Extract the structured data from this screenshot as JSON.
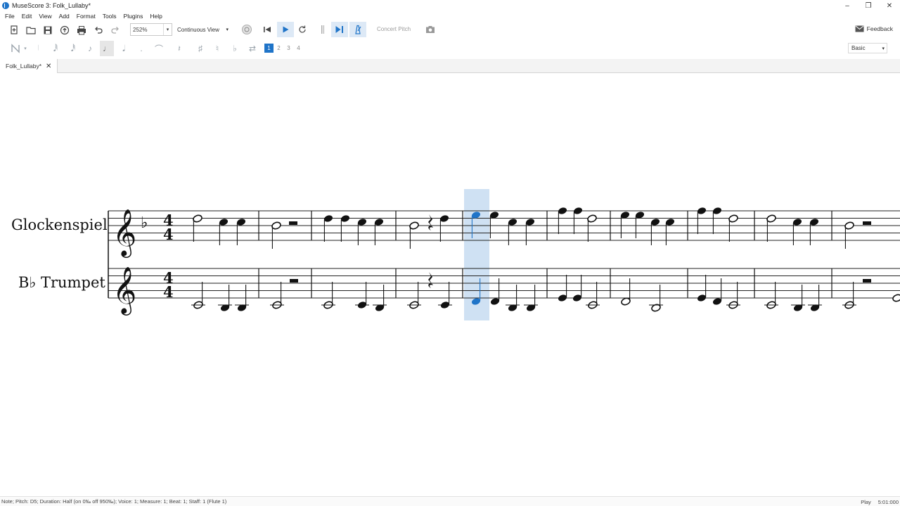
{
  "window": {
    "title": "MuseScore 3: Folk_Lullaby*"
  },
  "menu": [
    "File",
    "Edit",
    "View",
    "Add",
    "Format",
    "Tools",
    "Plugins",
    "Help"
  ],
  "toolbar": {
    "zoom": "252%",
    "view_mode": "Continuous View",
    "concert_pitch": "Concert Pitch",
    "feedback": "Feedback"
  },
  "note_input": {
    "voices": [
      "1",
      "2",
      "3",
      "4"
    ],
    "active_voice": "1",
    "workspace": "Basic"
  },
  "tabs": [
    {
      "label": "Folk_Lullaby*"
    }
  ],
  "score": {
    "instruments": [
      "Glockenspiel",
      "B♭ Trumpet"
    ],
    "time_signature": [
      "4",
      "4"
    ],
    "selected_measure": 5
  },
  "status": {
    "left": "Note; Pitch: D5; Duration: Half (on 0‰ off 950‰); Voice: 1;  Measure: 1; Beat: 1; Staff: 1 (Flute 1)",
    "mode": "Play",
    "time": "5:01:000"
  },
  "colors": {
    "accent": "#1f74c8",
    "selection": "#cfe1f3"
  }
}
